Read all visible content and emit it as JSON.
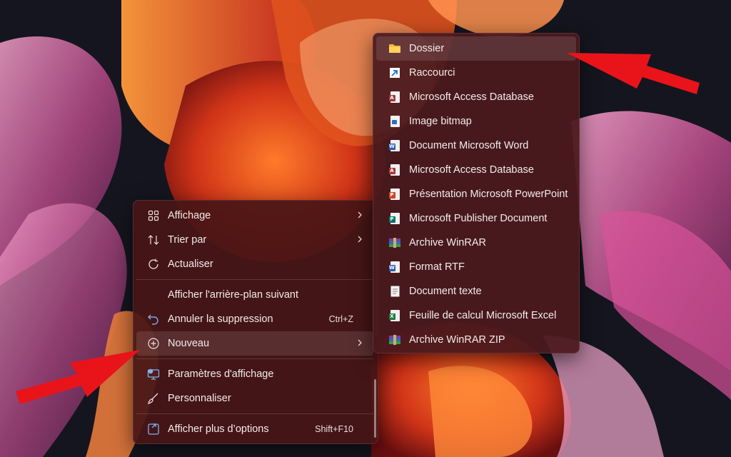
{
  "context_menu": {
    "items": [
      {
        "label": "Affichage",
        "icon": "grid-icon",
        "submenu": true
      },
      {
        "label": "Trier par",
        "icon": "sort-icon",
        "submenu": true
      },
      {
        "label": "Actualiser",
        "icon": "refresh-icon"
      },
      {
        "label": "Afficher l'arrière-plan suivant",
        "icon": null
      },
      {
        "label": "Annuler la suppression",
        "icon": "undo-icon",
        "shortcut": "Ctrl+Z"
      },
      {
        "label": "Nouveau",
        "icon": "plus-circle-icon",
        "submenu": true,
        "highlighted": true
      },
      {
        "label": "Paramètres d'affichage",
        "icon": "display-settings-icon"
      },
      {
        "label": "Personnaliser",
        "icon": "brush-icon"
      },
      {
        "label": "Afficher plus d’options",
        "icon": "more-options-icon",
        "shortcut": "Shift+F10"
      }
    ]
  },
  "new_submenu": {
    "items": [
      {
        "label": "Dossier",
        "icon": "folder-icon",
        "highlighted": true
      },
      {
        "label": "Raccourci",
        "icon": "shortcut-icon"
      },
      {
        "label": "Microsoft Access Database",
        "icon": "access-file-icon"
      },
      {
        "label": "Image bitmap",
        "icon": "bitmap-file-icon"
      },
      {
        "label": "Document Microsoft Word",
        "icon": "word-file-icon"
      },
      {
        "label": "Microsoft Access Database",
        "icon": "access-file-icon"
      },
      {
        "label": "Présentation Microsoft PowerPoint",
        "icon": "powerpoint-file-icon"
      },
      {
        "label": "Microsoft Publisher Document",
        "icon": "publisher-file-icon"
      },
      {
        "label": "Archive WinRAR",
        "icon": "winrar-icon"
      },
      {
        "label": "Format RTF",
        "icon": "rtf-file-icon"
      },
      {
        "label": "Document texte",
        "icon": "text-file-icon"
      },
      {
        "label": "Feuille de calcul Microsoft Excel",
        "icon": "excel-file-icon"
      },
      {
        "label": "Archive WinRAR ZIP",
        "icon": "winrar-zip-icon"
      }
    ]
  },
  "colors": {
    "menu_bg": "#481616",
    "highlight": "#ffffff1c",
    "annotation_arrow": "#e8141a"
  }
}
